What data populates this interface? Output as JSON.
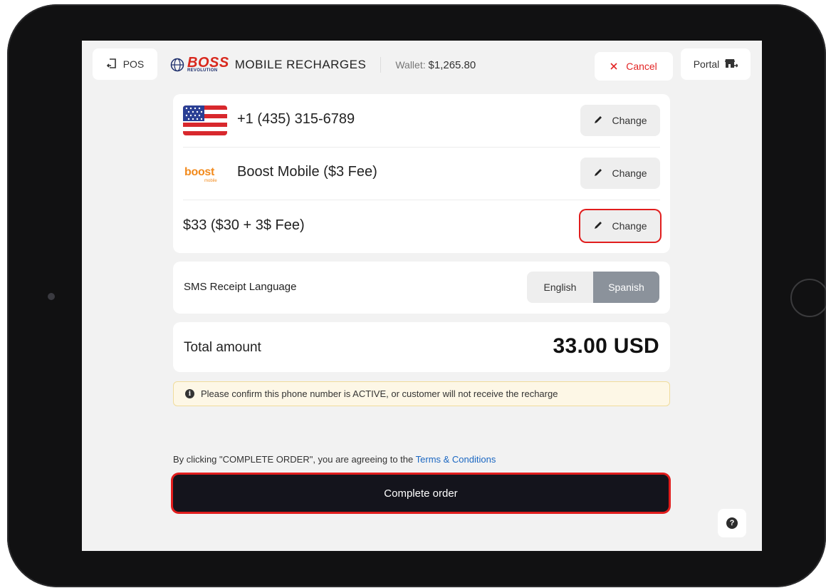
{
  "header": {
    "pos_label": "POS",
    "brand_logo_text": "BOSS",
    "brand_logo_subtext": "REVOLUTION",
    "app_title": "MOBILE RECHARGES",
    "wallet_label": "Wallet:",
    "wallet_amount": "$1,265.80",
    "cancel_label": "Cancel",
    "portal_label": "Portal"
  },
  "order": {
    "phone_number": "+1 (435) 315-6789",
    "carrier_logo_text": "boost",
    "carrier_logo_subtext": "mobile",
    "carrier": "Boost Mobile ($3 Fee)",
    "amount": "$33 ($30 + 3$ Fee)",
    "change_label": "Change"
  },
  "sms": {
    "label": "SMS Receipt Language",
    "options": [
      "English",
      "Spanish"
    ],
    "selected": "Spanish"
  },
  "total": {
    "label": "Total amount",
    "value": "33.00 USD"
  },
  "notice": {
    "text": "Please confirm this phone number is ACTIVE, or customer will not receive the recharge"
  },
  "footer": {
    "terms_prefix": "By clicking \"COMPLETE ORDER\", you are agreeing to the ",
    "terms_link": "Terms & Conditions",
    "complete_label": "Complete order"
  },
  "colors": {
    "accent_red": "#e11d1d",
    "link_blue": "#1b67c2",
    "selected_segment": "#8b929b",
    "primary_button": "#14141c"
  },
  "icons": [
    "pos-exit-icon",
    "cancel-x-icon",
    "portal-store-icon",
    "us-flag-icon",
    "pencil-icon",
    "info-icon",
    "help-icon"
  ]
}
